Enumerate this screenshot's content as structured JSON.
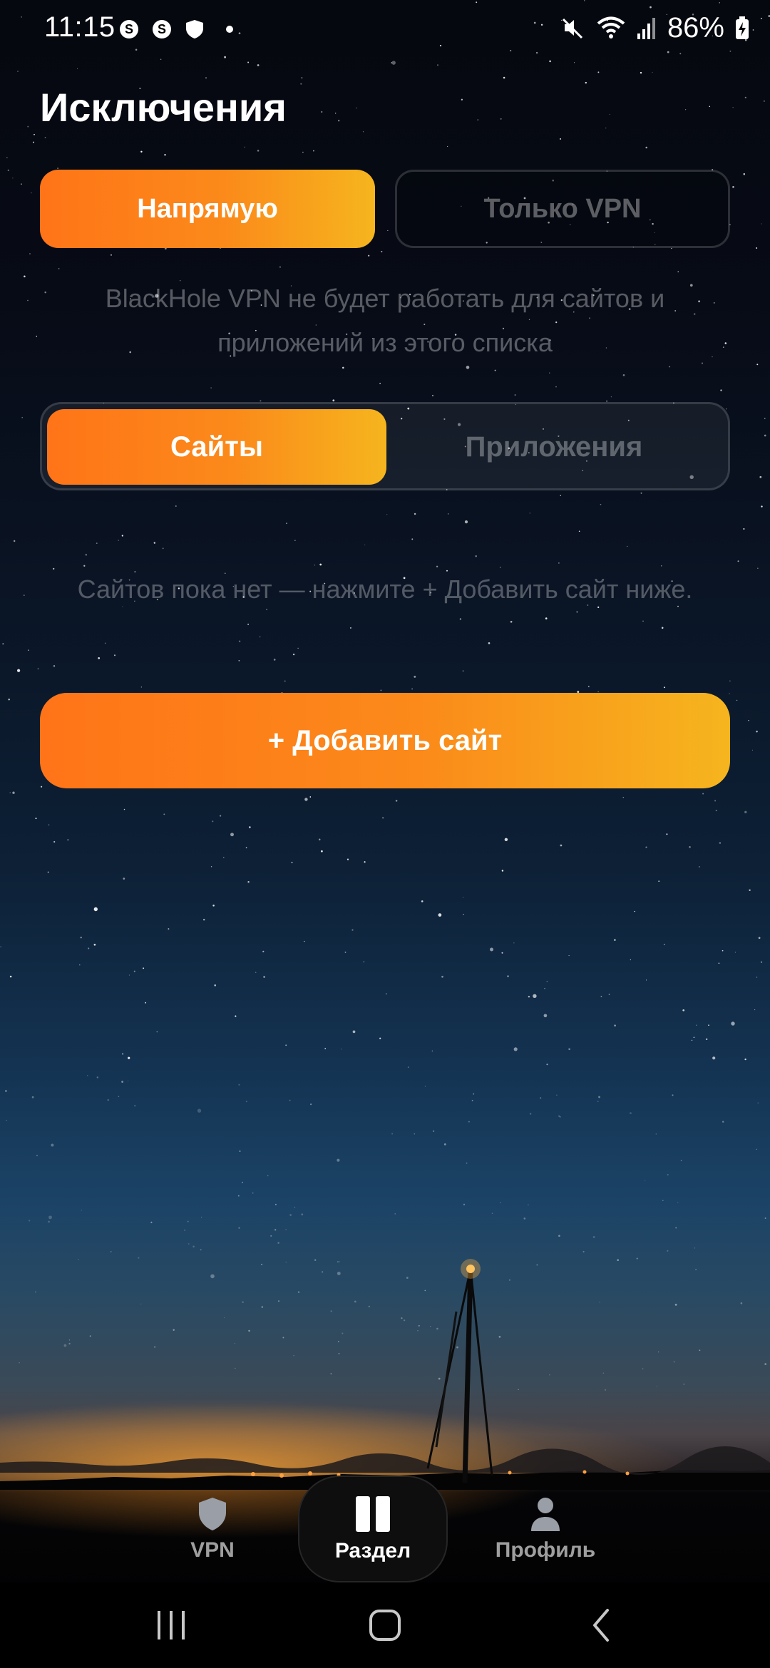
{
  "status_bar": {
    "time": "11:15",
    "battery": "86%",
    "icons": [
      "s-circle-icon",
      "s-circle-icon",
      "shield-icon",
      "dot-icon",
      "mute-icon",
      "wifi-icon",
      "signal-icon",
      "battery-charging-icon"
    ]
  },
  "page": {
    "title": "Исключения"
  },
  "mode_toggle": {
    "direct_label": "Напрямую",
    "vpn_only_label": "Только VPN",
    "selected": "Напрямую"
  },
  "description": "BlackHole VPN не будет работать для сайтов и приложений из этого списка",
  "segmented": {
    "sites_label": "Сайты",
    "apps_label": "Приложения",
    "selected": "Сайты"
  },
  "empty_hint": "Сайтов пока нет — нажмите + Добавить сайт ниже.",
  "add_button": {
    "label": "+ Добавить сайт"
  },
  "bottom_nav": {
    "items": [
      {
        "label": "VPN",
        "icon": "shield-icon",
        "active": false
      },
      {
        "label": "Раздел",
        "icon": "split-icon",
        "active": true
      },
      {
        "label": "Профиль",
        "icon": "person-icon",
        "active": false
      }
    ]
  },
  "system_nav": {
    "buttons": [
      "recents-icon",
      "home-icon",
      "back-icon"
    ]
  },
  "colors": {
    "accent_start": "#ff7418",
    "accent_end": "#f6b51e",
    "background_top": "#06080f",
    "background_bottom": "#000000"
  }
}
